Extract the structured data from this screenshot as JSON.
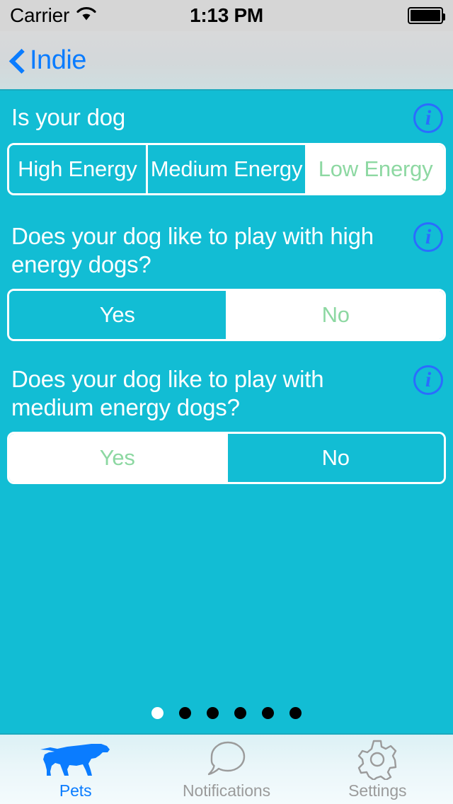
{
  "status_bar": {
    "carrier": "Carrier",
    "wifi_icon": "wifi-icon",
    "time": "1:13 PM",
    "battery_icon": "battery-full-icon"
  },
  "nav_bar": {
    "back_icon": "chevron-left-icon",
    "back_label": "Indie"
  },
  "colors": {
    "background_teal": "#12bdd4",
    "accent_blue": "#0a7cff",
    "selected_text_green": "#8dd8a2",
    "segment_border_white": "#ffffff",
    "info_icon_blue": "#2b6cff",
    "tab_inactive_gray": "#9b9b9b"
  },
  "questions": [
    {
      "text": "Is your dog",
      "info_icon": "info-icon",
      "options": [
        {
          "label": "High Energy",
          "selected": false
        },
        {
          "label": "Medium Energy",
          "selected": false
        },
        {
          "label": "Low Energy",
          "selected": true
        }
      ]
    },
    {
      "text": "Does your dog like to play with high energy dogs?",
      "info_icon": "info-icon",
      "options": [
        {
          "label": "Yes",
          "selected": false
        },
        {
          "label": "No",
          "selected": true
        }
      ]
    },
    {
      "text": "Does your dog like to play with medium energy dogs?",
      "info_icon": "info-icon",
      "options": [
        {
          "label": "Yes",
          "selected": true
        },
        {
          "label": "No",
          "selected": false
        }
      ]
    }
  ],
  "page_control": {
    "total": 6,
    "current": 1
  },
  "tab_bar": {
    "items": [
      {
        "label": "Pets",
        "icon": "dog-icon",
        "active": true
      },
      {
        "label": "Notifications",
        "icon": "speech-bubble-icon",
        "active": false
      },
      {
        "label": "Settings",
        "icon": "gear-icon",
        "active": false
      }
    ]
  }
}
